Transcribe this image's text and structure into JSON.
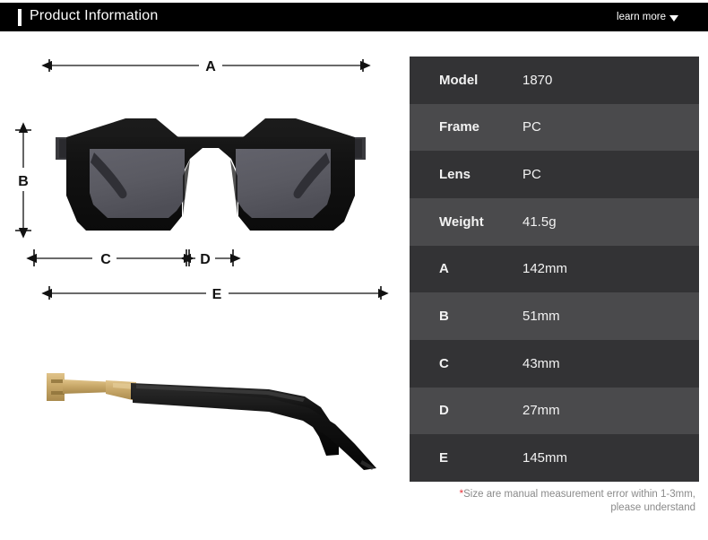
{
  "header": {
    "title": "Product Information",
    "learn_more_label": "learn more",
    "caret_icon": "chevron-down-icon",
    "background_color": "#000000",
    "text_color": "#ffffff"
  },
  "diagram": {
    "front_view_alt": "oversized square black sunglasses front view",
    "side_view_alt": "black sunglasses temple arm side view with gold hinge",
    "frame_color": "#111111",
    "lens_color": "#5a5a62",
    "hinge_gold_color": "#c9a96a",
    "dimension_labels": {
      "a": "A",
      "b": "B",
      "c": "C",
      "d": "D",
      "e": "E"
    }
  },
  "spec_table": {
    "row_color_odd": "#333335",
    "row_color_even": "#4a4a4c",
    "rows": [
      {
        "key": "Model",
        "value": "1870"
      },
      {
        "key": "Frame",
        "value": "PC"
      },
      {
        "key": "Lens",
        "value": "PC"
      },
      {
        "key": "Weight",
        "value": "41.5g"
      },
      {
        "key": "A",
        "value": "142mm"
      },
      {
        "key": "B",
        "value": "51mm"
      },
      {
        "key": "C",
        "value": "43mm"
      },
      {
        "key": "D",
        "value": "27mm"
      },
      {
        "key": "E",
        "value": "145mm"
      }
    ]
  },
  "footnote": {
    "star": "*",
    "line1": "Size are manual measurement error within 1-3mm,",
    "line2": "please understand",
    "star_color": "#e8333a",
    "text_color": "#8a8a8a"
  }
}
